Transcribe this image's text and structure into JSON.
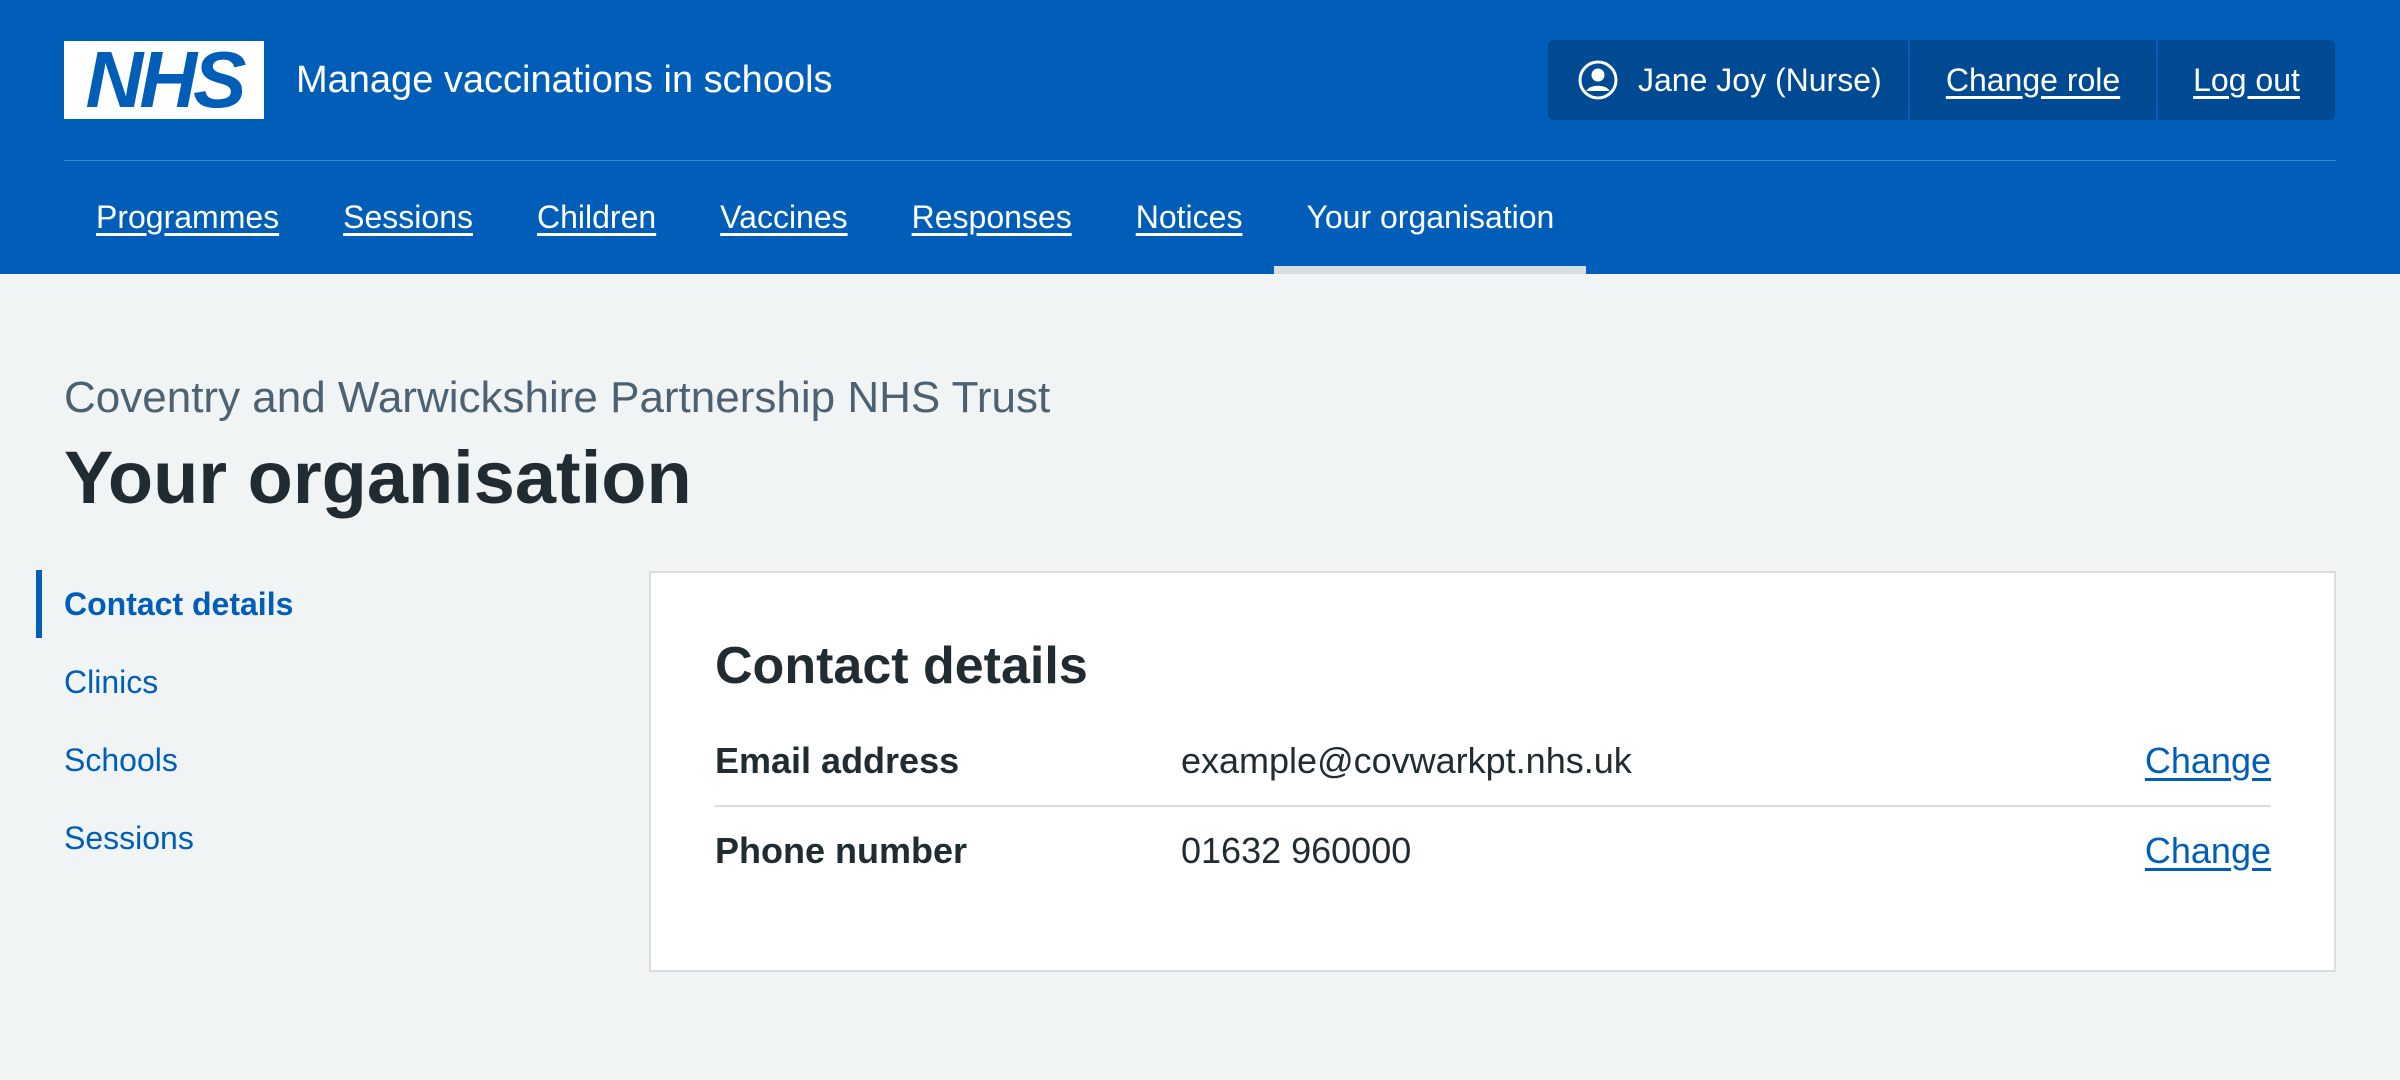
{
  "brand": {
    "logo_text": "NHS",
    "service_name": "Manage vaccinations in schools",
    "primary_color": "#005eb8",
    "account_bg_color": "#004a94"
  },
  "account": {
    "user_icon": "user-circle-icon",
    "user_name": "Jane Joy (Nurse)",
    "change_role_label": "Change role",
    "logout_label": "Log out"
  },
  "nav": {
    "items": [
      {
        "label": "Programmes"
      },
      {
        "label": "Sessions"
      },
      {
        "label": "Children"
      },
      {
        "label": "Vaccines"
      },
      {
        "label": "Responses"
      },
      {
        "label": "Notices"
      },
      {
        "label": "Your organisation"
      }
    ],
    "current": "Your organisation"
  },
  "page": {
    "caption": "Coventry and Warwickshire Partnership NHS Trust",
    "title": "Your organisation"
  },
  "sidenav": {
    "items": [
      {
        "label": "Contact details"
      },
      {
        "label": "Clinics"
      },
      {
        "label": "Schools"
      },
      {
        "label": "Sessions"
      }
    ],
    "current": "Contact details"
  },
  "contact_card": {
    "title": "Contact details",
    "rows": [
      {
        "key": "Email address",
        "value": "example@covwarkpt.nhs.uk",
        "action": "Change"
      },
      {
        "key": "Phone number",
        "value": "01632 960000",
        "action": "Change"
      }
    ]
  }
}
